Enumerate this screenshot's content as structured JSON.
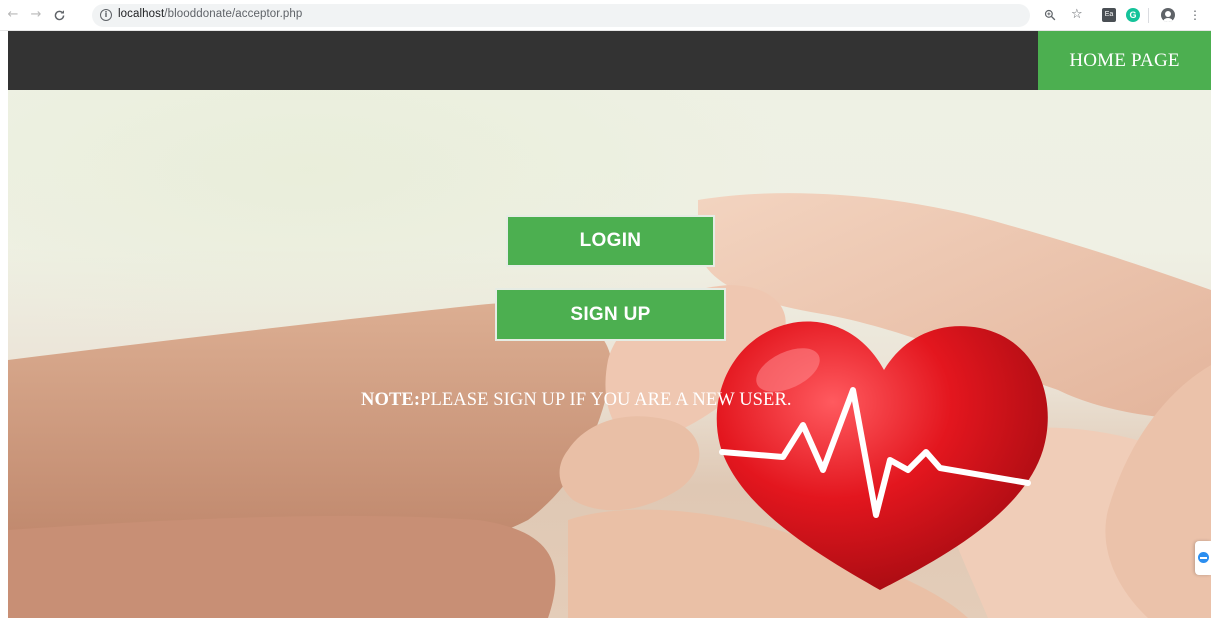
{
  "browser": {
    "url_host": "localhost",
    "url_path": "/blooddonate/acceptor.php",
    "icons": [
      "back-icon",
      "forward-icon",
      "reload-icon",
      "info-icon",
      "zoom-icon",
      "star-icon",
      "extension-icon",
      "grammarly-icon",
      "account-icon",
      "menu-icon"
    ]
  },
  "nav": {
    "home_label": "HOME PAGE"
  },
  "hero": {
    "login_label": "LOGIN",
    "signup_label": "SIGN UP",
    "note_prefix": "NOTE:",
    "note_text": "PLEASE SIGN UP IF YOU ARE A NEW USER."
  },
  "colors": {
    "nav_bg": "#333333",
    "accent_green": "#4caf50",
    "heart_red": "#d8161c"
  }
}
